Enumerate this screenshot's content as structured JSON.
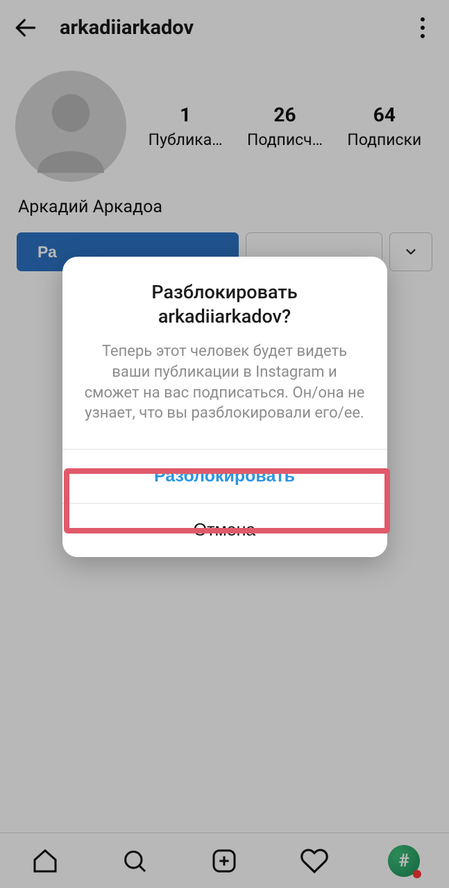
{
  "header": {
    "username": "arkadiiarkadov"
  },
  "profile": {
    "display_name": "Аркадий Аркадоа",
    "stats": {
      "posts": {
        "count": "1",
        "label": "Публика…"
      },
      "followers": {
        "count": "26",
        "label": "Подписч…"
      },
      "following": {
        "count": "64",
        "label": "Подписки"
      }
    },
    "primary_button_partial": "Ра"
  },
  "dialog": {
    "title": "Разблокировать arkadiiarkadov?",
    "body": "Теперь этот человек будет видеть ваши публикации в Instagram и сможет на вас подписаться. Он/она не узнает, что вы разблокировали его/ее.",
    "unblock": "Разблокировать",
    "cancel": "Отмена"
  }
}
